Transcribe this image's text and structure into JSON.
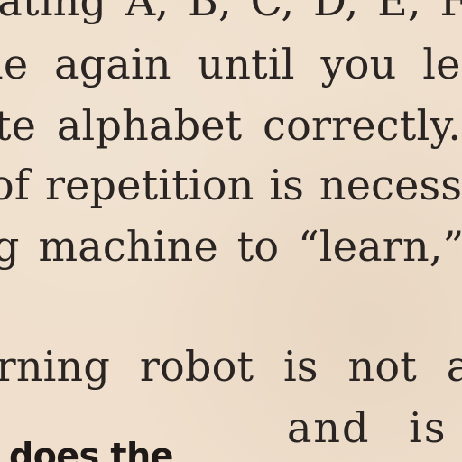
{
  "document": {
    "lines": [
      "eating A, B, C, D, E, F",
      "me again until you lea",
      "te alphabet correctly. '",
      "of repetition is necessar",
      "g machine to “learn,” to",
      "arning robot is not a",
      "and is",
      "does the"
    ]
  }
}
